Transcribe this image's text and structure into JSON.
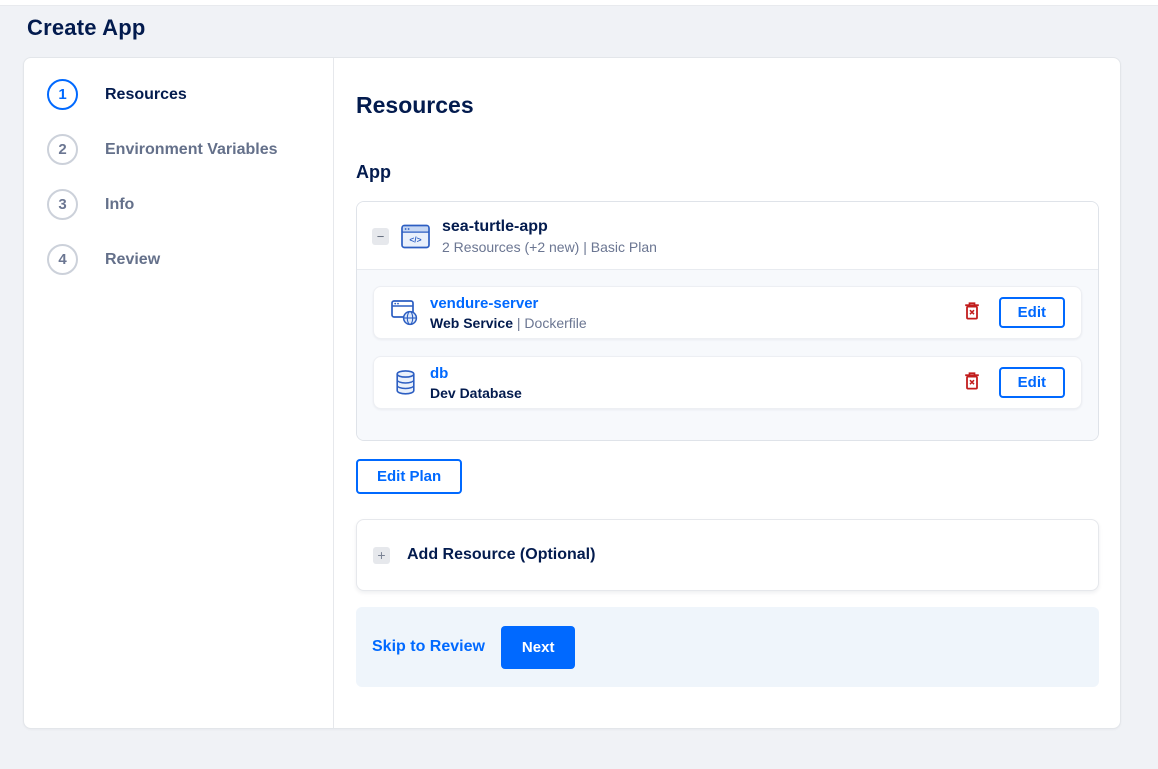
{
  "page": {
    "title": "Create App"
  },
  "steps": [
    {
      "number": "1",
      "label": "Resources"
    },
    {
      "number": "2",
      "label": "Environment Variables"
    },
    {
      "number": "3",
      "label": "Info"
    },
    {
      "number": "4",
      "label": "Review"
    }
  ],
  "main": {
    "heading": "Resources",
    "section_heading": "App",
    "app": {
      "name": "sea-turtle-app",
      "summary": "2 Resources (+2 new) | Basic Plan",
      "collapse_glyph": "−",
      "resources": [
        {
          "name": "vendure-server",
          "subtitle_bold": "Web Service",
          "subtitle_rest": " | Dockerfile",
          "edit_label": "Edit"
        },
        {
          "name": "db",
          "subtitle_bold": "Dev Database",
          "subtitle_rest": "",
          "edit_label": "Edit"
        }
      ]
    },
    "edit_plan_label": "Edit Plan",
    "add_resource": {
      "plus_glyph": "+",
      "label": "Add Resource (Optional)"
    },
    "footer": {
      "skip_label": "Skip to Review",
      "next_label": "Next"
    }
  },
  "colors": {
    "accent": "#0069ff",
    "navy": "#031b4e",
    "danger": "#c21d1d"
  }
}
